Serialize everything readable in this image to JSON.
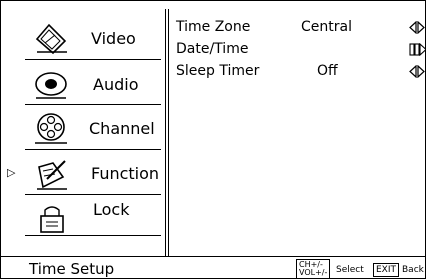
{
  "menu": {
    "items": [
      {
        "label": "Video",
        "icon": "video-icon"
      },
      {
        "label": "Audio",
        "icon": "audio-icon"
      },
      {
        "label": "Channel",
        "icon": "channel-icon"
      },
      {
        "label": "Function",
        "icon": "function-icon"
      },
      {
        "label": "Lock",
        "icon": "lock-icon"
      }
    ],
    "selected": "Function",
    "selector_glyph": "▷"
  },
  "settings": [
    {
      "name": "Time Zone",
      "value": "Central",
      "control": "left-right-arrows"
    },
    {
      "name": "Date/Time",
      "value": "",
      "control": "enter-arrow"
    },
    {
      "name": "Sleep Timer",
      "value": "Off",
      "control": "left-right-arrows"
    }
  ],
  "footer": {
    "title": "Time Setup",
    "select_key_line1": "CH+/-",
    "select_key_line2": "VOL+/-",
    "select_label": "Select",
    "back_key": "EXIT",
    "back_label": "Back"
  }
}
